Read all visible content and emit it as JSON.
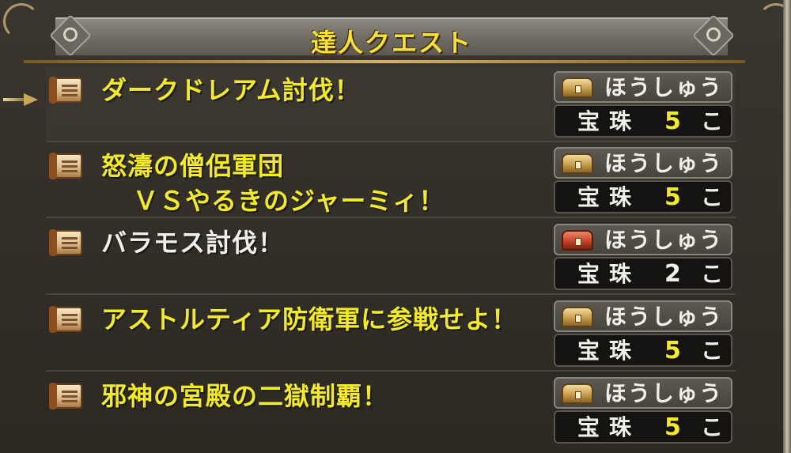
{
  "window": {
    "title": "達人クエスト"
  },
  "quests": [
    {
      "title_line1": "ダークドレアム討伐！",
      "title_line2": "",
      "title_color": "yellow",
      "reward_label": "ほうしゅう",
      "chest": "gold",
      "item": "宝珠",
      "count": "5",
      "unit": "こ",
      "count_color": "yellow"
    },
    {
      "title_line1": "怒濤の僧侶軍団",
      "title_line2": "ＶＳやるきのジャーミィ！",
      "title_color": "yellow",
      "reward_label": "ほうしゅう",
      "chest": "gold",
      "item": "宝珠",
      "count": "5",
      "unit": "こ",
      "count_color": "yellow"
    },
    {
      "title_line1": "バラモス討伐！",
      "title_line2": "",
      "title_color": "white",
      "reward_label": "ほうしゅう",
      "chest": "red",
      "item": "宝珠",
      "count": "2",
      "unit": "こ",
      "count_color": "white"
    },
    {
      "title_line1": "アストルティア防衛軍に参戦せよ！",
      "title_line2": "",
      "title_color": "yellow",
      "reward_label": "ほうしゅう",
      "chest": "gold",
      "item": "宝珠",
      "count": "5",
      "unit": "こ",
      "count_color": "yellow"
    },
    {
      "title_line1": "邪神の宮殿の二獄制覇！",
      "title_line2": "",
      "title_color": "yellow",
      "reward_label": "ほうしゅう",
      "chest": "gold",
      "item": "宝珠",
      "count": "5",
      "unit": "こ",
      "count_color": "yellow"
    }
  ],
  "colors": {
    "yellow": "#f2ea2a",
    "white": "#f0f0ea",
    "gold_trim": "#d8b060"
  }
}
